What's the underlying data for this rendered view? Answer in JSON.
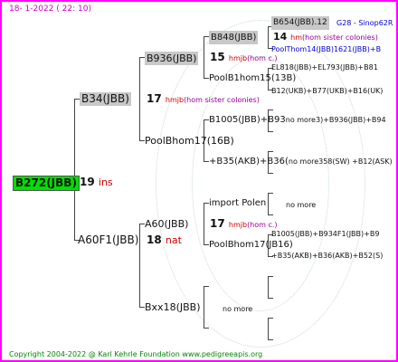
{
  "header": {
    "date_text": "18-   1-2022  ( 22:  10)"
  },
  "root": {
    "name": "B272(JBB)",
    "gen": "19",
    "gen_suffix": "ins"
  },
  "gen1": {
    "top": {
      "name": "B34(JBB)",
      "gen": "17",
      "gen_suffix": "hmjb",
      "note": "(hom sister colonies)"
    },
    "bottom": {
      "name": "A60F1(JBB)",
      "gen": "18",
      "gen_suffix": "nat"
    }
  },
  "gen2": {
    "a": {
      "name": "B936(JBB)",
      "gen": "15",
      "gen_suffix": "hmjb",
      "note": "(hom c.)"
    },
    "b": {
      "name": "PoolBhom17(16B)"
    },
    "c": {
      "name": "A60(JBB)",
      "gen": "17",
      "gen_suffix": "hmjb",
      "note": "(hom c.)"
    },
    "d": {
      "name": "Bxx18(JBB)",
      "note": "no more"
    }
  },
  "gen3": {
    "a": {
      "name": "B848(JBB)",
      "gen": "14",
      "gen_suffix": "hm",
      "note": "(hom sister colonies)"
    },
    "b": {
      "name": "PoolB1hom15(13B)"
    },
    "c": {
      "name": "B1005(JBB)+B93",
      "overlay": "no more3)+B936(JBB)+B94"
    },
    "d": {
      "name": "+B35(AKB)+B36(",
      "overlay": "no more358(SW) +B12(ASK)"
    },
    "e": {
      "name": "import Polen",
      "note": "no more"
    },
    "f": {
      "name": "PoolBhom17(JB16)"
    }
  },
  "gen4": {
    "a": {
      "name": "B654(JBB).12",
      "extra": "G28 - Sinop62R"
    },
    "b": {
      "name": "PoolThom14(JBB)162",
      "extra": "1(JBB)+B"
    },
    "c": {
      "name": "EL818(JBB)+EL793(JBB)+B81"
    },
    "d": {
      "name": "B12(UKB)+B77(UKB)+B16(UK)"
    },
    "e": {
      "name": "B1005(JBB)+B934F1(JBB)+B9"
    },
    "f": {
      "name": "+B35(AKB)+B36(AKB)+B52(S)"
    }
  },
  "footer": {
    "text": "Copyright 2004-2022 @ Karl Kehrle Foundation    www.pedigreeapis.org"
  }
}
